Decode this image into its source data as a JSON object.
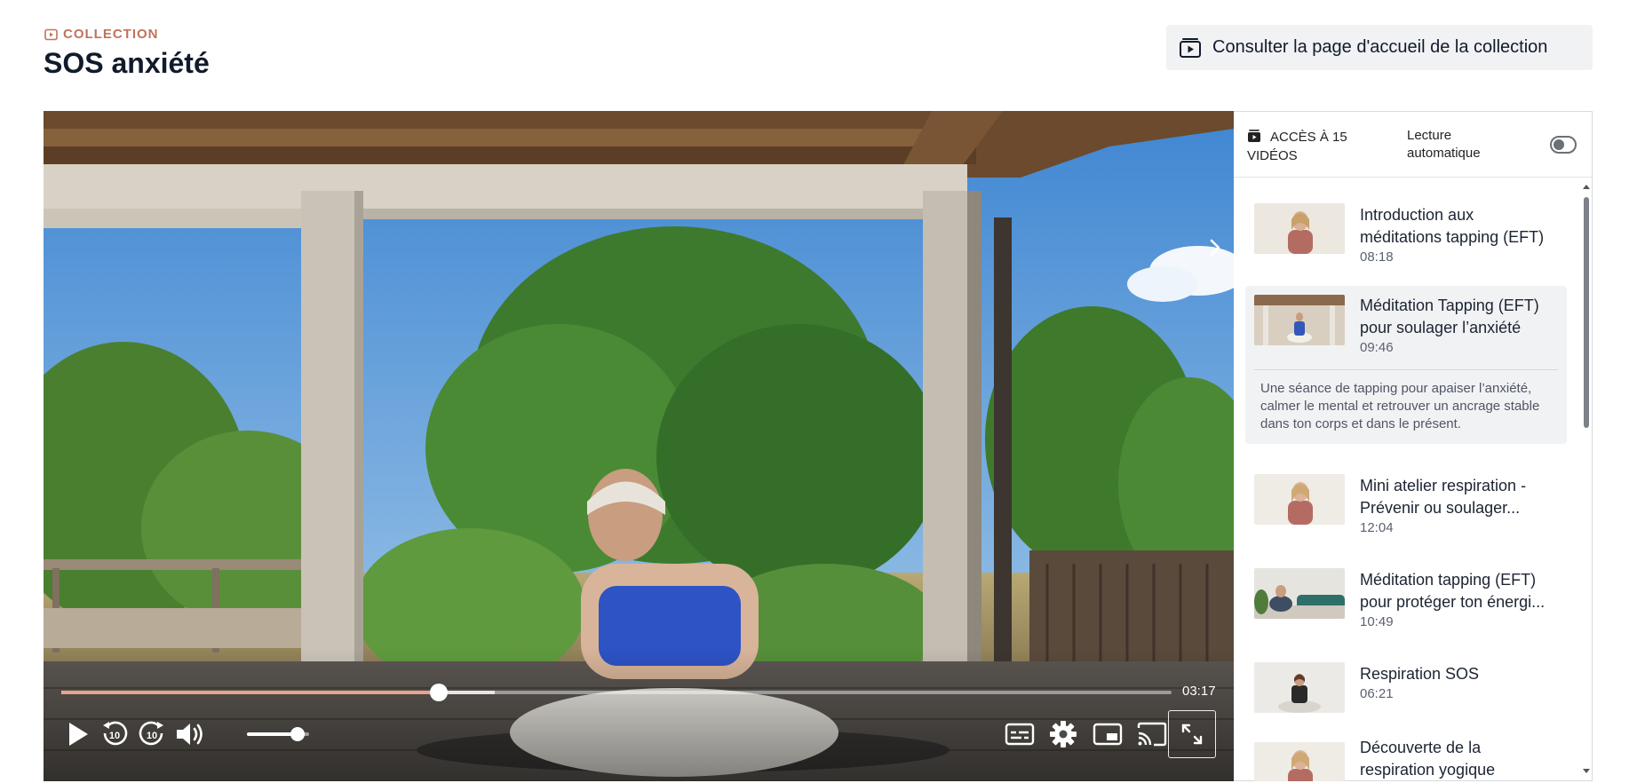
{
  "header": {
    "collection_tag": "COLLECTION",
    "title": "SOS anxiété",
    "home_button_label": "Consulter la page d'accueil de la collection"
  },
  "player": {
    "current_time": "03:17",
    "progress_fraction": 0.34,
    "buffered_fraction": 0.39,
    "volume_fraction": 0.82,
    "accent_color": "#e8a48a",
    "controls": [
      "play-icon",
      "rewind-10-icon",
      "forward-10-icon",
      "volume-icon",
      "subtitles-icon",
      "settings-icon",
      "picture-in-picture-icon",
      "cast-icon",
      "fullscreen-icon"
    ]
  },
  "sidebar": {
    "access_label": "ACCÈS À 15 VIDÉOS",
    "autoplay_label": "Lecture automatique",
    "autoplay_enabled": false,
    "videos": [
      {
        "title": "Introduction aux méditations tapping (EFT)",
        "duration": "08:18"
      },
      {
        "title": "Méditation Tapping (EFT) pour soulager l’anxiété",
        "duration": "09:46",
        "active": true,
        "description": "Une séance de tapping pour apaiser l’anxiété, calmer le mental et retrouver un ancrage stable dans ton corps et dans le présent."
      },
      {
        "title": "Mini atelier respiration - Prévenir ou soulager...",
        "duration": "12:04"
      },
      {
        "title": "Méditation tapping (EFT) pour protéger ton énergi...",
        "duration": "10:49"
      },
      {
        "title": "Respiration SOS",
        "duration": "06:21"
      },
      {
        "title": "Découverte de la respiration yogique",
        "duration": ""
      }
    ]
  }
}
